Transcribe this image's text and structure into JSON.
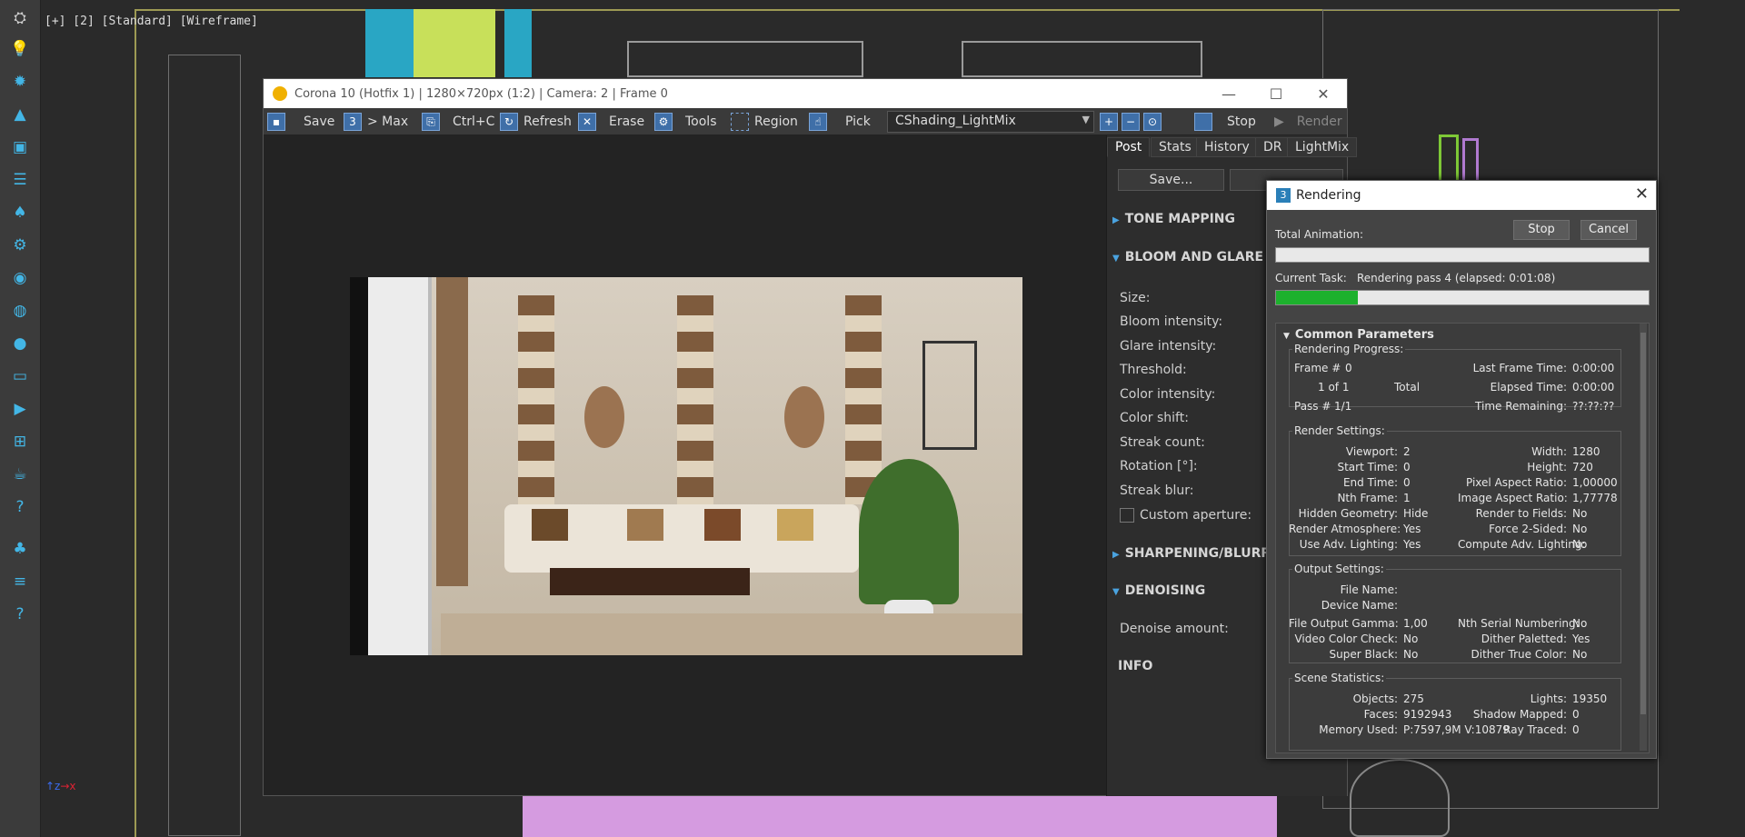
{
  "viewport": {
    "label": "[+] [2] [Standard] [Wireframe]"
  },
  "vfb": {
    "title": "Corona 10 (Hotfix 1) | 1280×720px (1:2) | Camera: 2 | Frame 0",
    "toolbar": {
      "save": "Save",
      "to_max": "> Max",
      "copy": "Ctrl+C",
      "refresh": "Refresh",
      "erase": "Erase",
      "tools": "Tools",
      "region": "Region",
      "pick": "Pick",
      "render_element": "CShading_LightMix",
      "stop": "Stop",
      "render": "Render"
    },
    "tabs": [
      "Post",
      "Stats",
      "History",
      "DR",
      "LightMix"
    ],
    "save_button": "Save...",
    "sections": {
      "tone_mapping": "TONE MAPPING",
      "bloom_glare": "BLOOM AND GLARE",
      "sharpening": "SHARPENING/BLURRING",
      "denoising": "DENOISING",
      "info": "INFO"
    },
    "bloom_props": [
      "Size:",
      "Bloom intensity:",
      "Glare intensity:",
      "Threshold:",
      "Color intensity:",
      "Color shift:",
      "Streak count:",
      "Rotation [°]:",
      "Streak blur:"
    ],
    "custom_aperture": "Custom aperture:",
    "denoise_amount": "Denoise amount:"
  },
  "rendering": {
    "title": "Rendering",
    "stop": "Stop",
    "cancel": "Cancel",
    "total_animation_label": "Total Animation:",
    "total_progress": 0,
    "current_task_label": "Current Task:",
    "current_task": "Rendering pass 4 (elapsed: 0:01:08)",
    "task_progress": 0.22,
    "common_params": "Common Parameters",
    "progress": {
      "label": "Rendering Progress:",
      "frame_label": "Frame #",
      "frame": "0",
      "of": "1 of 1",
      "total": "Total",
      "pass_label": "Pass #",
      "pass": "1/1",
      "last_frame_label": "Last Frame Time:",
      "last_frame": "0:00:00",
      "elapsed_label": "Elapsed Time:",
      "elapsed": "0:00:00",
      "remaining_label": "Time Remaining:",
      "remaining": "??:??:??"
    },
    "settings": {
      "label": "Render Settings:",
      "left": [
        [
          "Viewport:",
          "2"
        ],
        [
          "Start Time:",
          "0"
        ],
        [
          "End Time:",
          "0"
        ],
        [
          "Nth Frame:",
          "1"
        ],
        [
          "Hidden Geometry:",
          "Hide"
        ],
        [
          "Render Atmosphere:",
          "Yes"
        ],
        [
          "Use Adv. Lighting:",
          "Yes"
        ]
      ],
      "right": [
        [
          "Width:",
          "1280"
        ],
        [
          "Height:",
          "720"
        ],
        [
          "Pixel Aspect Ratio:",
          "1,00000"
        ],
        [
          "Image Aspect Ratio:",
          "1,77778"
        ],
        [
          "Render to Fields:",
          "No"
        ],
        [
          "Force 2-Sided:",
          "No"
        ],
        [
          "Compute Adv. Lighting:",
          "No"
        ]
      ]
    },
    "output": {
      "label": "Output Settings:",
      "file_name": "File Name:",
      "device_name": "Device Name:",
      "left": [
        [
          "File Output Gamma:",
          "1,00"
        ],
        [
          "Video Color Check:",
          "No"
        ],
        [
          "Super Black:",
          "No"
        ]
      ],
      "right": [
        [
          "Nth Serial Numbering:",
          "No"
        ],
        [
          "Dither Paletted:",
          "Yes"
        ],
        [
          "Dither True Color:",
          "No"
        ]
      ]
    },
    "scene": {
      "label": "Scene Statistics:",
      "objects_label": "Objects:",
      "objects": "275",
      "faces_label": "Faces:",
      "faces": "9192943",
      "memory_label": "Memory Used:",
      "memory": "P:7597,9M V:10879,6",
      "lights_label": "Lights:",
      "lights": "19350",
      "shadow_label": "Shadow Mapped:",
      "shadow": "0",
      "raytraced_label": "Ray Traced:",
      "raytraced": "0"
    }
  },
  "colors": {
    "accent": "#1db12d",
    "viewport_label": "#dddddd",
    "gizmo_blue": "#43b6e6"
  }
}
